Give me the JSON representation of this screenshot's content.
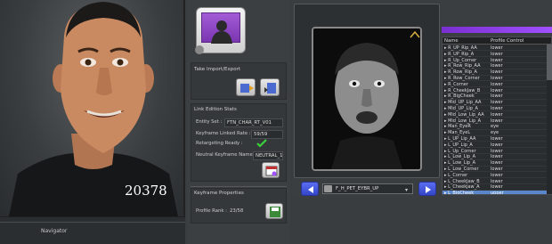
{
  "viewport": {
    "frame_number": "20378",
    "navigator_label": "Navigator"
  },
  "take_import_export": {
    "title": "Take Import/Export"
  },
  "link_edition_stats": {
    "title": "Link Edition Stats",
    "entity_set_label": "Entity Set :",
    "entity_set_value": "FTN_CHAR_RT_V01",
    "keyframe_linked_rate_label": "Keyframe Linked Rate :",
    "keyframe_linked_rate_value": "59/59",
    "retargeting_ready_label": "Retargeting Ready :",
    "neutral_keyframe_label": "Neutral Keyframe Name :",
    "neutral_keyframe_value": "NEUTRAL_1"
  },
  "keyframe_properties": {
    "title": "Keyframe Properties",
    "profile_rank_label": "Profile Rank :",
    "profile_rank_value": "23/58"
  },
  "profile_table": {
    "headers": [
      "Name",
      "Profile Control"
    ],
    "rows": [
      [
        "R_UP_Rip_AA",
        "lower"
      ],
      [
        "R_UP_Rip_A",
        "lower"
      ],
      [
        "R_Up_Corner",
        "lower"
      ],
      [
        "R_Row_Rip_AA",
        "lower"
      ],
      [
        "R_Row_Rip_A",
        "lower"
      ],
      [
        "R_Row_Corner",
        "lower"
      ],
      [
        "R_Corner",
        "lower"
      ],
      [
        "R_CheekJaw_B",
        "lower"
      ],
      [
        "R_BigCheek",
        "lower"
      ],
      [
        "Mid_UP_Lip_AA",
        "lower"
      ],
      [
        "Mid_UP_Lip_A",
        "lower"
      ],
      [
        "Mid_Low_Lip_AA",
        "lower"
      ],
      [
        "Mid_Low_Lip_A",
        "lower"
      ],
      [
        "Man_EyeR",
        "eye"
      ],
      [
        "Man_EyeL",
        "eye"
      ],
      [
        "L_UP_Lip_AA",
        "lower"
      ],
      [
        "L_UP_Lip_A",
        "lower"
      ],
      [
        "L_Up_Corner",
        "lower"
      ],
      [
        "L_Low_Lip_A",
        "lower"
      ],
      [
        "L_Low_Lip_A",
        "lower"
      ],
      [
        "L_Low_Corner",
        "lower"
      ],
      [
        "L_Corner",
        "lower"
      ],
      [
        "L_CheekJaw_B",
        "lower"
      ],
      [
        "L_Cheekjaw_A",
        "lower"
      ],
      [
        "L_BigCheek",
        "upper"
      ]
    ],
    "selected_index": 24
  },
  "keyframe_selector": {
    "value": "F_H_PET_EYBR_UP"
  },
  "colors": {
    "accent": "#8a3ce0",
    "selection": "#5a87c9",
    "check": "#3bd13b"
  }
}
